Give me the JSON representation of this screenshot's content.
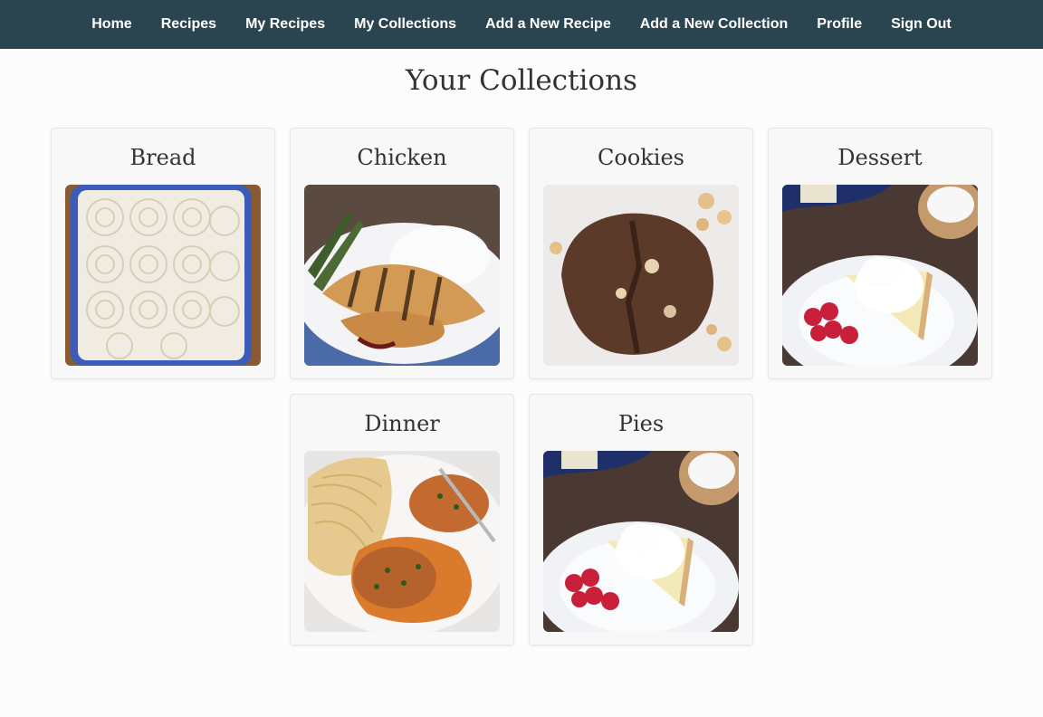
{
  "nav": {
    "items": [
      "Home",
      "Recipes",
      "My Recipes",
      "My Collections",
      "Add a New Recipe",
      "Add a New Collection",
      "Profile",
      "Sign Out"
    ]
  },
  "page": {
    "title": "Your Collections"
  },
  "collections": [
    {
      "name": "Bread",
      "image": "cinnamon-rolls-photo"
    },
    {
      "name": "Chicken",
      "image": "grilled-chicken-photo"
    },
    {
      "name": "Cookies",
      "image": "chocolate-cookie-photo"
    },
    {
      "name": "Dessert",
      "image": "cream-pie-photo"
    },
    {
      "name": "Dinner",
      "image": "chicken-spaghetti-photo"
    },
    {
      "name": "Pies",
      "image": "cream-pie-photo"
    }
  ]
}
